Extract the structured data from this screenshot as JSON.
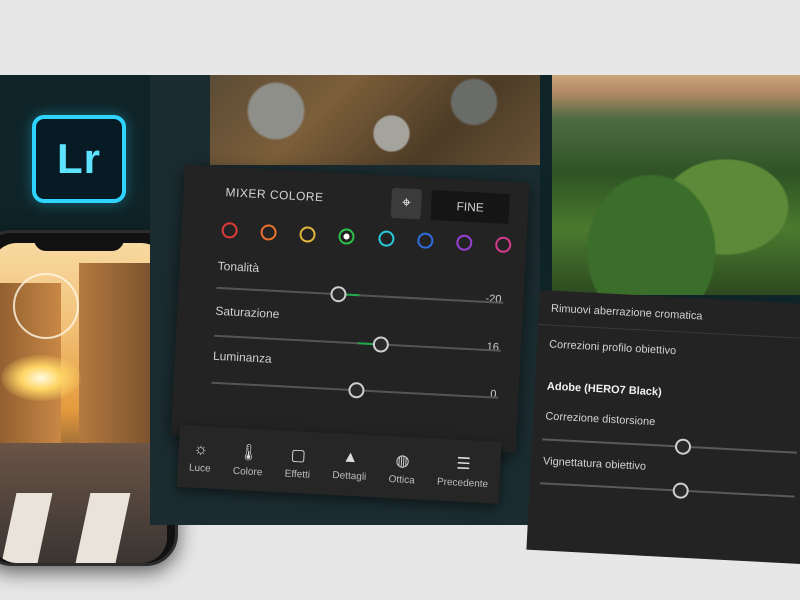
{
  "logo": {
    "text": "Lr"
  },
  "mixer": {
    "title": "MIXER COLORE",
    "done_label": "FINE",
    "target_icon": "target-icon",
    "swatches": [
      {
        "name": "red",
        "color": "#e03b3b",
        "selected": false
      },
      {
        "name": "orange",
        "color": "#e8702b",
        "selected": false
      },
      {
        "name": "yellow",
        "color": "#e2b63a",
        "selected": false
      },
      {
        "name": "green",
        "color": "#2bc24a",
        "selected": true
      },
      {
        "name": "aqua",
        "color": "#29c9d9",
        "selected": false
      },
      {
        "name": "blue",
        "color": "#2f6de0",
        "selected": false
      },
      {
        "name": "purple",
        "color": "#9a3fd6",
        "selected": false
      },
      {
        "name": "magenta",
        "color": "#d63a8f",
        "selected": false
      }
    ],
    "sliders": [
      {
        "label": "Tonalità",
        "value": "-20",
        "position": 0.42
      },
      {
        "label": "Saturazione",
        "value": "16",
        "position": 0.58
      },
      {
        "label": "Luminanza",
        "value": "0",
        "position": 0.5
      }
    ]
  },
  "toolbar": {
    "items": [
      {
        "label": "Luce",
        "icon": "sun-icon"
      },
      {
        "label": "Colore",
        "icon": "thermometer-icon"
      },
      {
        "label": "Effetti",
        "icon": "vignette-icon"
      },
      {
        "label": "Dettagli",
        "icon": "triangle-icon"
      },
      {
        "label": "Ottica",
        "icon": "lens-icon"
      },
      {
        "label": "Precedente",
        "icon": "presets-icon"
      }
    ]
  },
  "optics": {
    "chromatic": "Rimuovi aberrazione cromatica",
    "profile": "Correzioni profilo obiettivo",
    "camera": "Adobe (HERO7 Black)",
    "distortion_label": "Correzione distorsione",
    "vignette_label": "Vignettatura obiettivo",
    "distortion_position": 0.55,
    "vignette_position": 0.55
  },
  "colors": {
    "accent": "#2fd3ff",
    "slider_fill": "#1fa84a",
    "panel": "#232323"
  }
}
